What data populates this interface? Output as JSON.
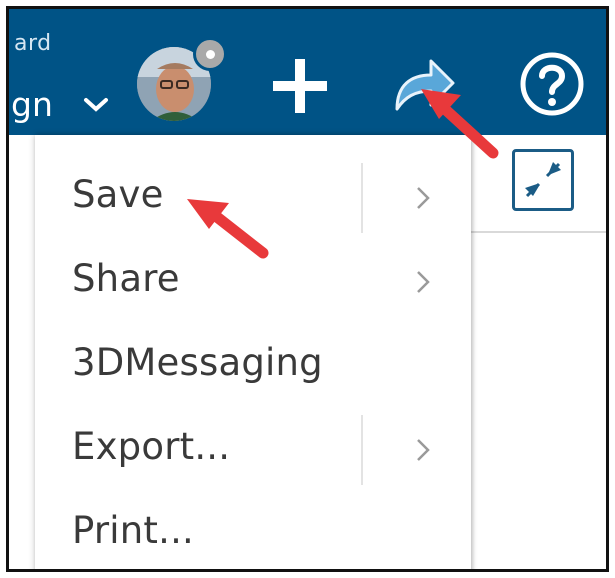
{
  "header": {
    "title_fragment": "ard",
    "subtitle_fragment": "gn",
    "avatar_alt": "user avatar",
    "colors": {
      "bar": "#005386",
      "accent": "#1b5c86"
    }
  },
  "toolbar": {
    "plus_icon": "plus-icon",
    "share_icon": "share-arrow-icon",
    "help_icon": "help-icon",
    "collapse_icon": "collapse-icon"
  },
  "menu": {
    "items": [
      {
        "label": "Save",
        "has_submenu": true
      },
      {
        "label": "Share",
        "has_submenu": true
      },
      {
        "label": "3DMessaging",
        "has_submenu": false
      },
      {
        "label": "Export...",
        "has_submenu": true
      },
      {
        "label": "Print...",
        "has_submenu": false
      }
    ]
  },
  "annotations": {
    "arrow_color": "#e8393b"
  }
}
